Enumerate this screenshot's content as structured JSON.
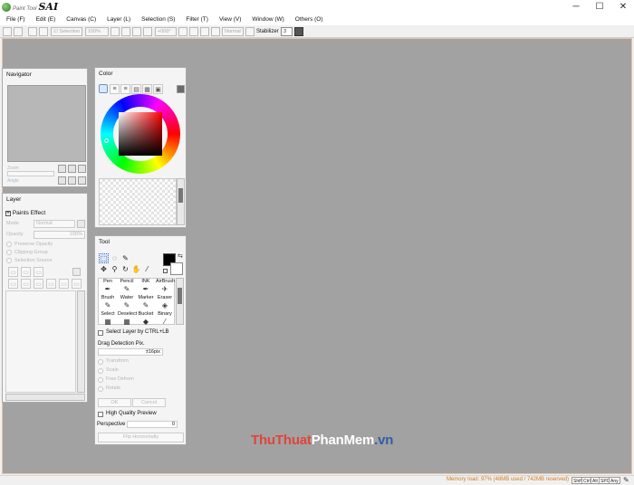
{
  "app": {
    "logo_small": "Paint Tool",
    "logo_big": "SAI",
    "window_buttons": [
      "─",
      "☐",
      "✕"
    ]
  },
  "menu": [
    "File (F)",
    "Edit (E)",
    "Canvas (C)",
    "Layer (L)",
    "Selection (S)",
    "Filter (T)",
    "View (V)",
    "Window (W)",
    "Others (O)"
  ],
  "toolbar": {
    "selection_label": "Selection",
    "zoom": "100%",
    "angle": "+000°",
    "blend": "Normal",
    "stabilizer_label": "Stabilizer",
    "stabilizer_value": "3"
  },
  "navigator": {
    "title": "Navigator",
    "zoom_label": "Zoom",
    "angle_label": "Angle"
  },
  "color": {
    "title": "Color",
    "current": "#7a1010"
  },
  "layer": {
    "title": "Layer",
    "paints_effect": "Paints Effect",
    "mode_label": "Mode",
    "mode_value": "Normal",
    "opacity_label": "Opacity",
    "opacity_value": "100%",
    "options": [
      "Preserve Opacity",
      "Clipping Group",
      "Selection Source"
    ]
  },
  "tool": {
    "title": "Tool",
    "brushes_row1": [
      "Pen",
      "Pencil",
      "INK",
      "AirBrush"
    ],
    "brushes_row2": [
      "Brush",
      "Water",
      "Marker",
      "Eraser"
    ],
    "brushes_row3": [
      "Select",
      "Deselect",
      "Bucket",
      "Binary"
    ],
    "select_layer": "Select Layer by CTRL+LB",
    "drag_detection_label": "Drag Detection Pix.",
    "drag_detection_value": "±16pix",
    "transforms": [
      "Transform",
      "Scale",
      "Free Deform",
      "Rotate"
    ],
    "ok": "OK",
    "cancel": "Cancel",
    "hq_preview": "High Quality Preview",
    "perspective_label": "Perspective",
    "perspective_value": "0",
    "flip": "Flip Horizontally"
  },
  "status": {
    "memory": "Memory load: 97% (48MB used / 742MB reserved)",
    "keys": [
      "Shift",
      "Ctrl",
      "Alt",
      "SPC",
      "Any"
    ]
  },
  "watermark": {
    "part1": "ThuThuat",
    "part2": "PhanMem",
    "part3": ".vn"
  }
}
